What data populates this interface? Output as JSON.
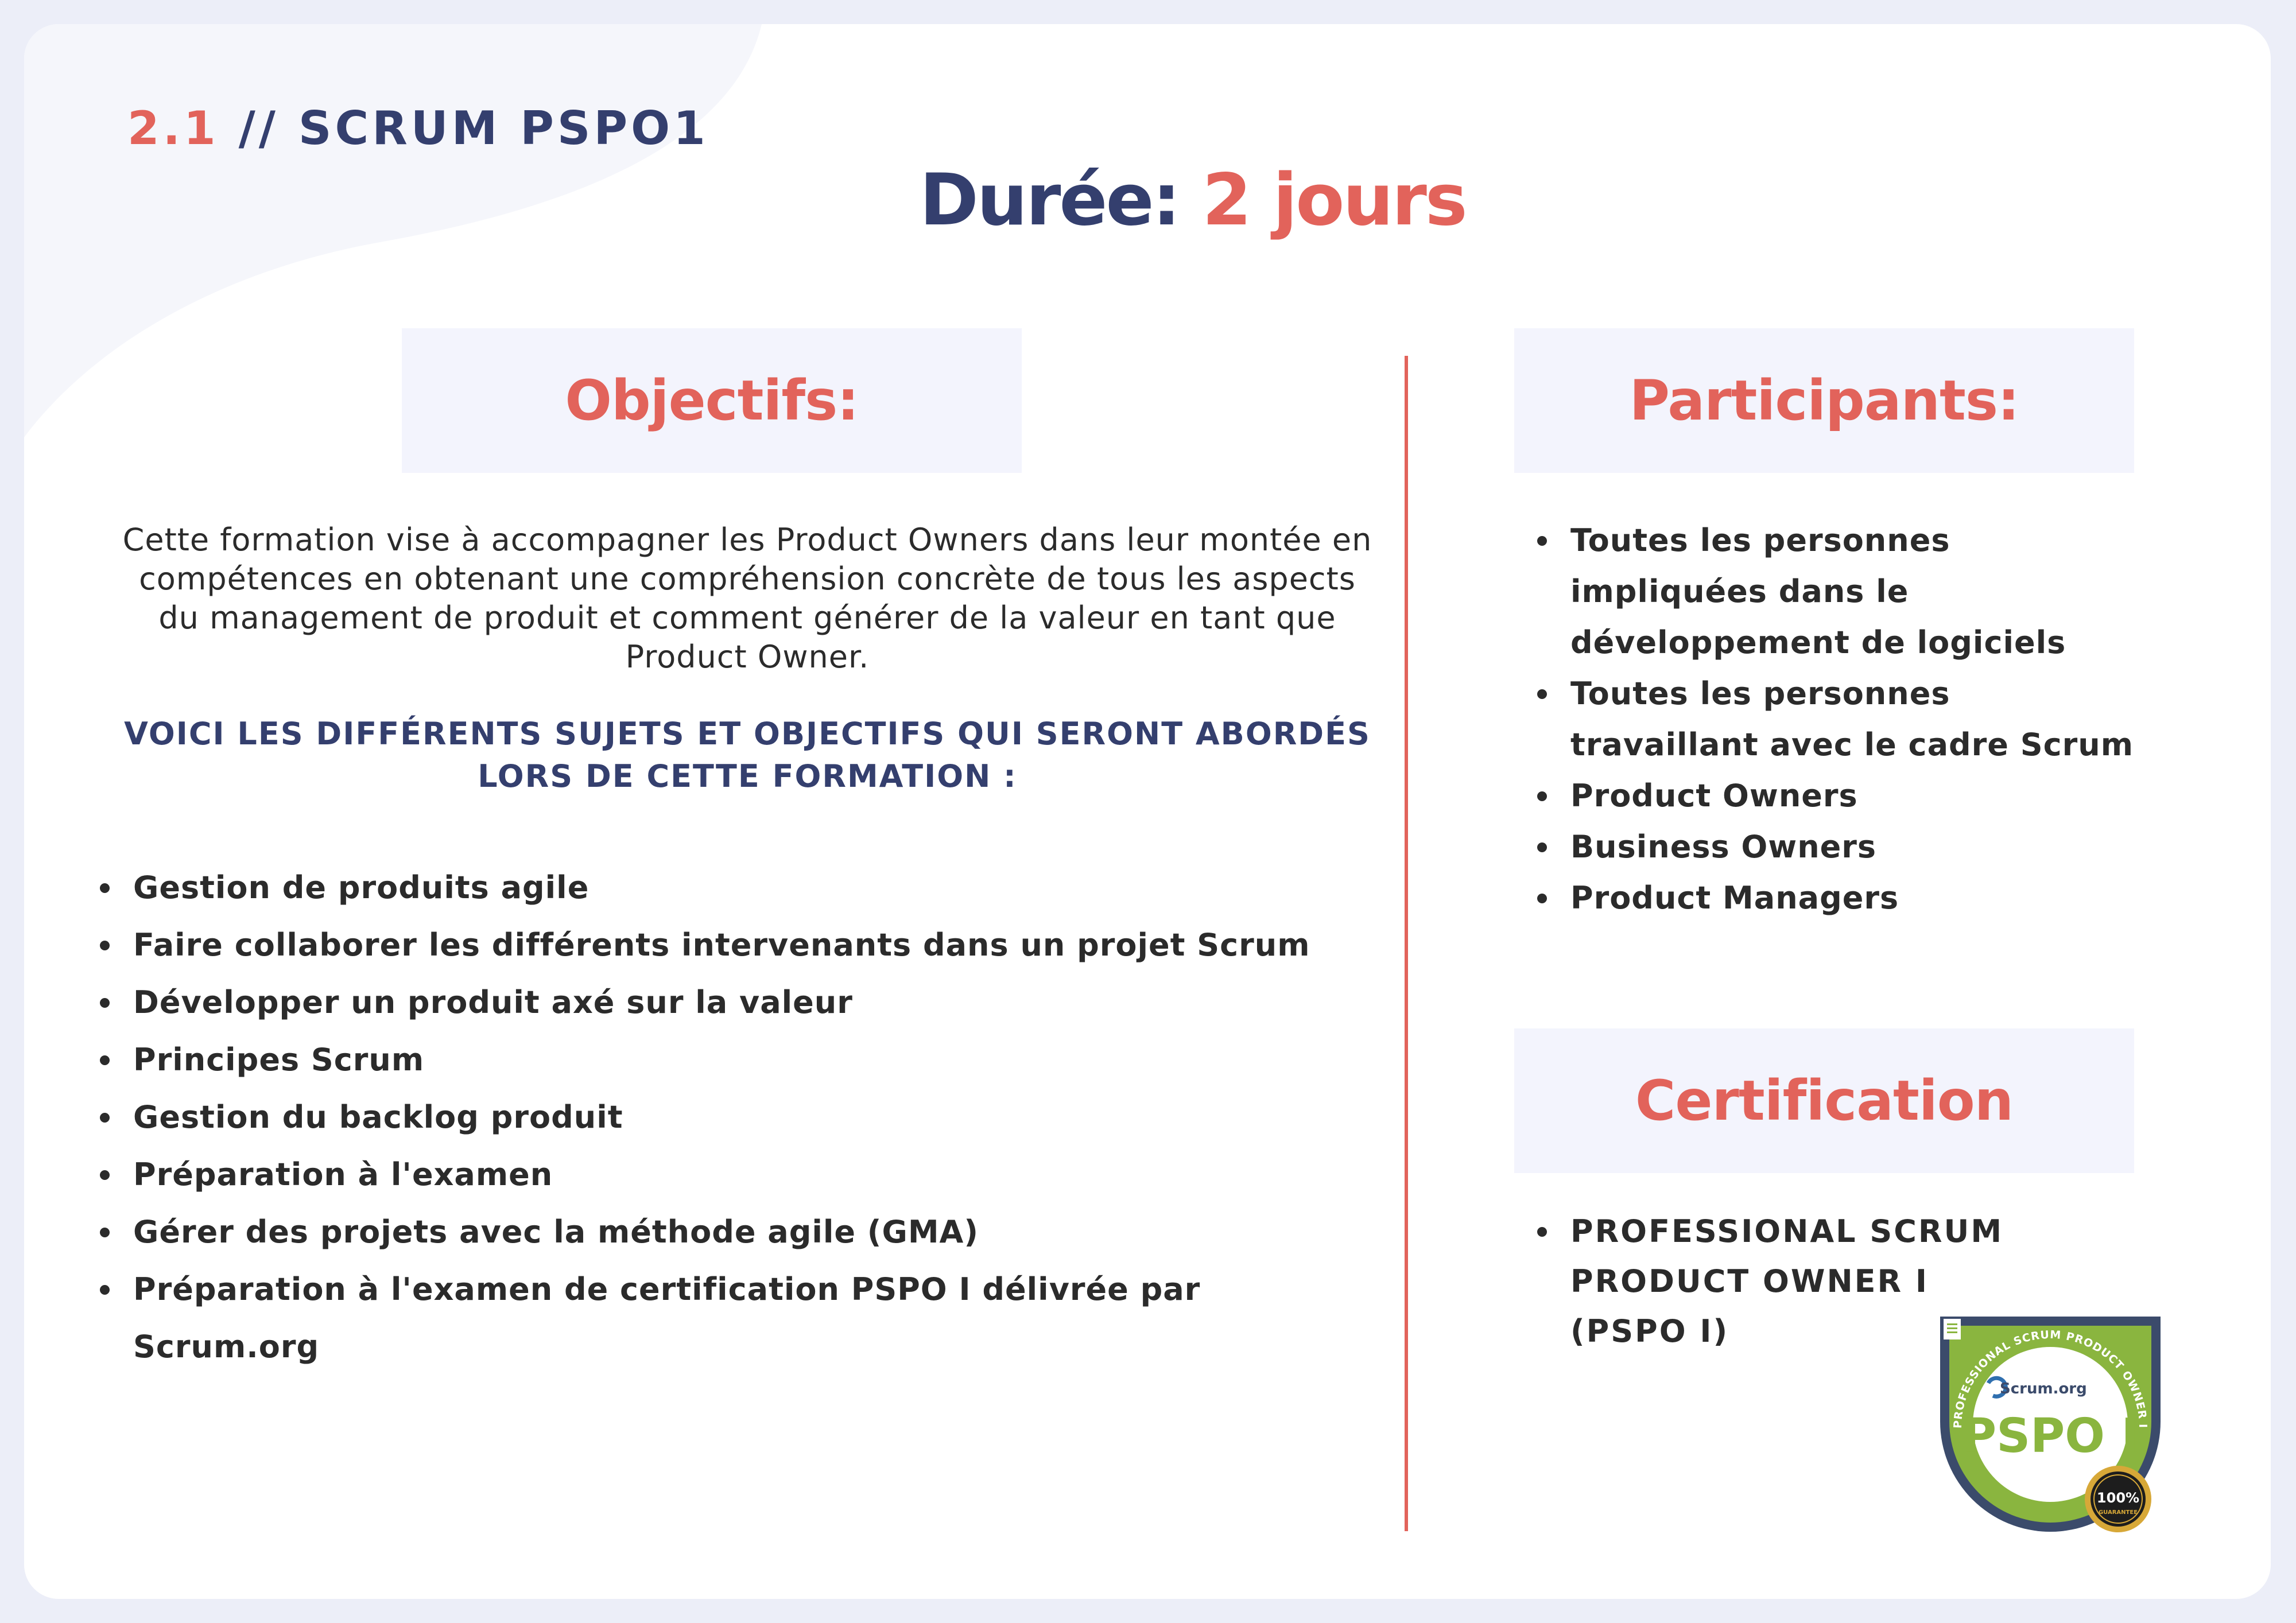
{
  "header": {
    "section_number": "2.1",
    "section_title": "// SCRUM PSPO1",
    "duration_label": "Durée:",
    "duration_value": "2 jours"
  },
  "objectifs": {
    "title": "Objectifs:",
    "intro": "Cette formation vise à accompagner les Product Owners dans leur montée en compétences en obtenant une compréhension concrète de tous les aspects du management de produit et comment générer de la valeur en tant que Product Owner.",
    "subjects_title": "VOICI LES DIFFÉRENTS SUJETS ET OBJECTIFS QUI SERONT ABORDÉS LORS DE CETTE FORMATION :",
    "items": [
      "Gestion de produits agile",
      "Faire collaborer les différents intervenants dans un projet Scrum",
      "Développer un produit axé sur la valeur",
      "Principes Scrum",
      "Gestion du backlog produit",
      "Préparation à l'examen",
      "Gérer des projets avec la méthode agile (GMA)",
      "Préparation à l'examen de certification PSPO I délivrée par Scrum.org"
    ]
  },
  "participants": {
    "title": "Participants:",
    "items": [
      "Toutes les personnes impliquées dans le développement de logiciels",
      "Toutes les personnes travaillant avec le cadre Scrum",
      "Product Owners",
      "Business Owners",
      "Product Managers"
    ]
  },
  "certification": {
    "title": "Certification",
    "items": [
      "PROFESSIONAL SCRUM PRODUCT OWNER I (PSPO I)"
    ]
  },
  "badge": {
    "ring_text": "PROFESSIONAL SCRUM PRODUCT OWNER I",
    "brand": "Scrum.org",
    "label": "PSPO I",
    "seal_value": "100%",
    "seal_text": "GUARANTEE"
  },
  "colors": {
    "accent": "#e2635b",
    "navy": "#343f6e",
    "heading_bg": "#f3f4fd",
    "page_bg": "#eceef8",
    "badge_green": "#8ab53f",
    "badge_navy": "#3b4b6b",
    "seal_gold": "#d7a838"
  }
}
